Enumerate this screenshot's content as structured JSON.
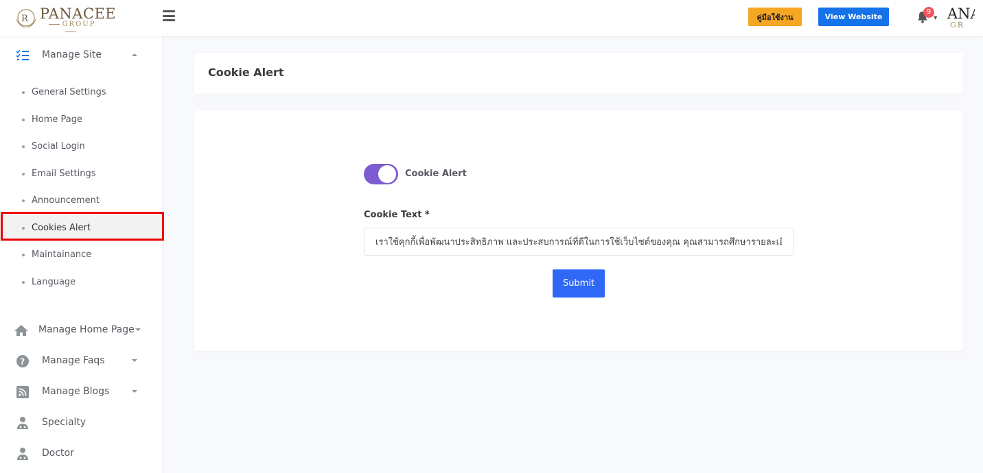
{
  "header": {
    "logo_text": "PANACEE",
    "logo_sub": "GROUP",
    "manual_button": "คู่มือใช้งาน",
    "view_website_button": "View Website",
    "notification_count": "9",
    "right_logo_text": "ANA",
    "right_logo_sub": "GR"
  },
  "sidebar": {
    "manage_site": "Manage Site",
    "sub_items": [
      "General Settings",
      "Home Page",
      "Social Login",
      "Email Settings",
      "Announcement",
      "Cookies Alert",
      "Maintainance",
      "Language"
    ],
    "active_item": "Cookies Alert",
    "manage_home_page": "Manage Home Page",
    "manage_faqs": "Manage Faqs",
    "manage_blogs": "Manage Blogs",
    "specialty": "Specialty",
    "doctor": "Doctor"
  },
  "main": {
    "page_title": "Cookie Alert",
    "toggle_label": "Cookie Alert",
    "toggle_on": true,
    "field_label": "Cookie Text *",
    "cookie_text_value": "เราใช้คุกกี้เพื่อพัฒนาประสิทธิภาพ และประสบการณ์ที่ดีในการใช้เว็บไซต์ของคุณ คุณสามารถศึกษารายละเอียดได้",
    "submit_button": "Submit"
  },
  "colors": {
    "toggle_accent": "#7d5bd0",
    "submit": "#2f67f6",
    "view_website": "#1572e8",
    "manual": "#f5a623",
    "badge": "#f3545d"
  }
}
